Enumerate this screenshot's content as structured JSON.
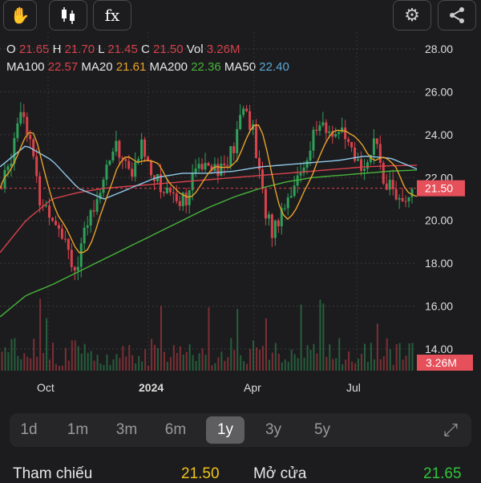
{
  "toolbar": {
    "left": [
      "hand-tool",
      "candlestick-type",
      "indicators"
    ],
    "fx_label": "fx"
  },
  "ohlc": {
    "o_label": "O",
    "o": "21.65",
    "h_label": "H",
    "h": "21.70",
    "l_label": "L",
    "l": "21.45",
    "c_label": "C",
    "c": "21.50",
    "vol_label": "Vol",
    "vol": "3.26M"
  },
  "ma": {
    "ma100_label": "MA100",
    "ma100": "22.57",
    "ma20_label": "MA20",
    "ma20": "21.61",
    "ma200_label": "MA200",
    "ma200": "22.36",
    "ma50_label": "MA50",
    "ma50": "22.40"
  },
  "colors": {
    "up": "#2fa05a",
    "down": "#d9424c",
    "ma100": "#d9424c",
    "ma20": "#e8a22a",
    "ma200": "#47b43a",
    "ma50": "#8fc8ea"
  },
  "chart_data": {
    "type": "candlestick",
    "y_ticks": [
      "28.00",
      "26.00",
      "24.00",
      "22.00",
      "20.00",
      "18.00",
      "16.00",
      "14.00"
    ],
    "ylim": [
      14,
      28
    ],
    "x_ticks": [
      {
        "label": "Oct",
        "bold": false
      },
      {
        "label": "2024",
        "bold": true
      },
      {
        "label": "Apr",
        "bold": false
      },
      {
        "label": "Jul",
        "bold": false
      }
    ],
    "last_price": "21.50",
    "last_price_value": 21.5,
    "last_volume": "3.26M",
    "close_path": [
      21.5,
      23,
      25.5,
      24,
      21,
      20.5,
      20,
      19,
      17.5,
      19.5,
      21,
      22,
      23.5,
      23,
      22,
      23.5,
      22.5,
      21.5,
      21.5,
      21,
      21.2,
      22.5,
      23,
      22.5,
      22.5,
      23.5,
      25.5,
      24,
      21,
      19.5,
      20.5,
      21.5,
      22,
      23.5,
      24.5,
      24,
      24.3,
      23.5,
      22.5,
      22.8,
      23.5,
      22,
      21.5,
      20.5,
      21.5
    ],
    "ma200": [
      15.5,
      16.5,
      17,
      17.6,
      18.2,
      18.8,
      19.4,
      20,
      20.6,
      21.1,
      21.5,
      21.8,
      22,
      22.1,
      22.2,
      22.3,
      22.35
    ],
    "ma100": [
      18.5,
      20,
      21,
      21.3,
      21.5,
      21.6,
      21.7,
      21.8,
      21.9,
      22,
      22.1,
      22.2,
      22.3,
      22.4,
      22.5,
      22.55,
      22.57
    ],
    "ma50": [
      22.5,
      23.5,
      22.8,
      21.5,
      21,
      21.5,
      22,
      22.2,
      22.2,
      22.3,
      22.5,
      22.6,
      22.7,
      22.8,
      23,
      22.9,
      22.4
    ]
  },
  "periods": [
    "1d",
    "1m",
    "3m",
    "6m",
    "1y",
    "3y",
    "5y"
  ],
  "active_period": "1y",
  "footer": {
    "ref_label": "Tham chiếu",
    "ref": "21.50",
    "open_label": "Mở cửa",
    "open": "21.65"
  }
}
